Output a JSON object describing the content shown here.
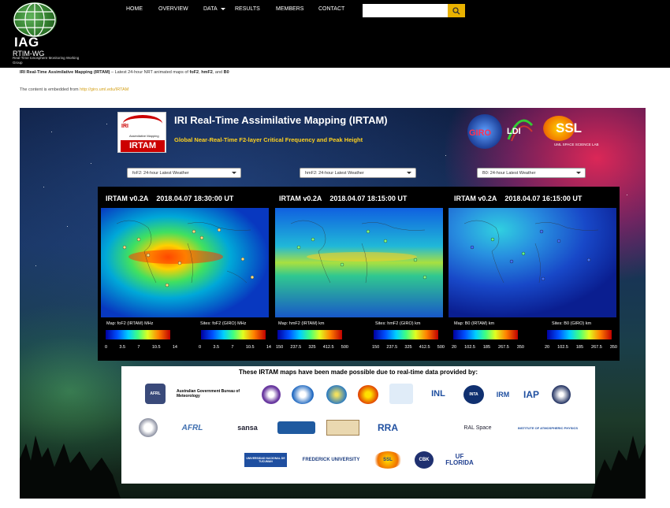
{
  "brand": {
    "logo_text": "IAG",
    "name": "RTIM-WG",
    "tagline": "Real-Time Ionosphere Monitoring Working Group"
  },
  "nav": {
    "items": [
      {
        "label": "HOME"
      },
      {
        "label": "OVERVIEW"
      },
      {
        "label": "DATA",
        "has_dropdown": true
      },
      {
        "label": "RESULTS"
      },
      {
        "label": "MEMBERS"
      },
      {
        "label": "CONTACT"
      }
    ],
    "search": {
      "value": "",
      "placeholder": ""
    }
  },
  "intro": {
    "title": "IRI Real-Time Assimilative Mapping (IRTAM)",
    "text": " – Latest 24-hour NRT animated maps of ",
    "p1": "foF2",
    "sep1": ", ",
    "p2": "hmF2",
    "sep2": ", and ",
    "p3": "B0",
    "embed_text": "The content is embedded from ",
    "embed_link": "http://giro.uml.edu/IRTAM"
  },
  "frame": {
    "logo_iri": "IRI",
    "logo_assim": "Assimilative Mapping",
    "logo_name": "IRTAM",
    "title": "IRI Real-Time Assimilative Mapping (IRTAM)",
    "subtitle": "Global Near-Real-Time F2-layer Critical Frequency and Peak Height",
    "partners": [
      "GIRO",
      "LDI",
      "SSL",
      "UML SPACE SCIENCE LAB"
    ],
    "selects": [
      {
        "value": "foF2: 24-hour Latest Weather"
      },
      {
        "value": "hmF2: 24-hour Latest Weather"
      },
      {
        "value": "B0: 24-hour Latest Weather"
      }
    ],
    "maps": [
      {
        "version": "IRTAM v0.2A",
        "timestamp": "2018.04.07 18:30:00 UT",
        "map_label": "Map: foF2 (IRTAM) MHz",
        "sites_label": "Sites: foF2 (GIRO) MHz",
        "ticks": [
          "0",
          "3.5",
          "7",
          "10.5",
          "14"
        ]
      },
      {
        "version": "IRTAM v0.2A",
        "timestamp": "2018.04.07 18:15:00 UT",
        "map_label": "Map: hmF2 (IRTAM) km",
        "sites_label": "Sites: hmF2 (GIRO) km",
        "ticks": [
          "150",
          "237.5",
          "325",
          "412.5",
          "500"
        ]
      },
      {
        "version": "IRTAM v0.2A",
        "timestamp": "2018.04.07 16:15:00 UT",
        "map_label": "Map: B0 (IRTAM) km",
        "sites_label": "Sites: B0 (GIRO) km",
        "ticks": [
          "20",
          "102.5",
          "185",
          "267.5",
          "350"
        ]
      }
    ],
    "sponsors_heading": "These IRTAM maps have been made possible due to real-time data provided by:",
    "sponsors": {
      "row1": [
        "AFRL",
        "Australian Government Bureau of Meteorology",
        "",
        "",
        "",
        "",
        "",
        "INL",
        "INTA",
        "IRM",
        "IAP",
        ""
      ],
      "row2": [
        "",
        "AFRL",
        "sansa",
        "",
        "",
        "RRA",
        "",
        "RAL Space",
        "INSTITUTE OF ATMOSPHERIC PHYSICS"
      ],
      "row3": [
        "UNIVERSIDAD NACIONAL DE TUCUMAN",
        "FREDERICK UNIVERSITY",
        "SSL",
        "CBK",
        "UF FLORIDA"
      ]
    }
  },
  "colors": {
    "accent": "#e9b200",
    "topbar": "#000000",
    "irtam_red": "#cc0000",
    "subtitle": "#ffd21f"
  }
}
